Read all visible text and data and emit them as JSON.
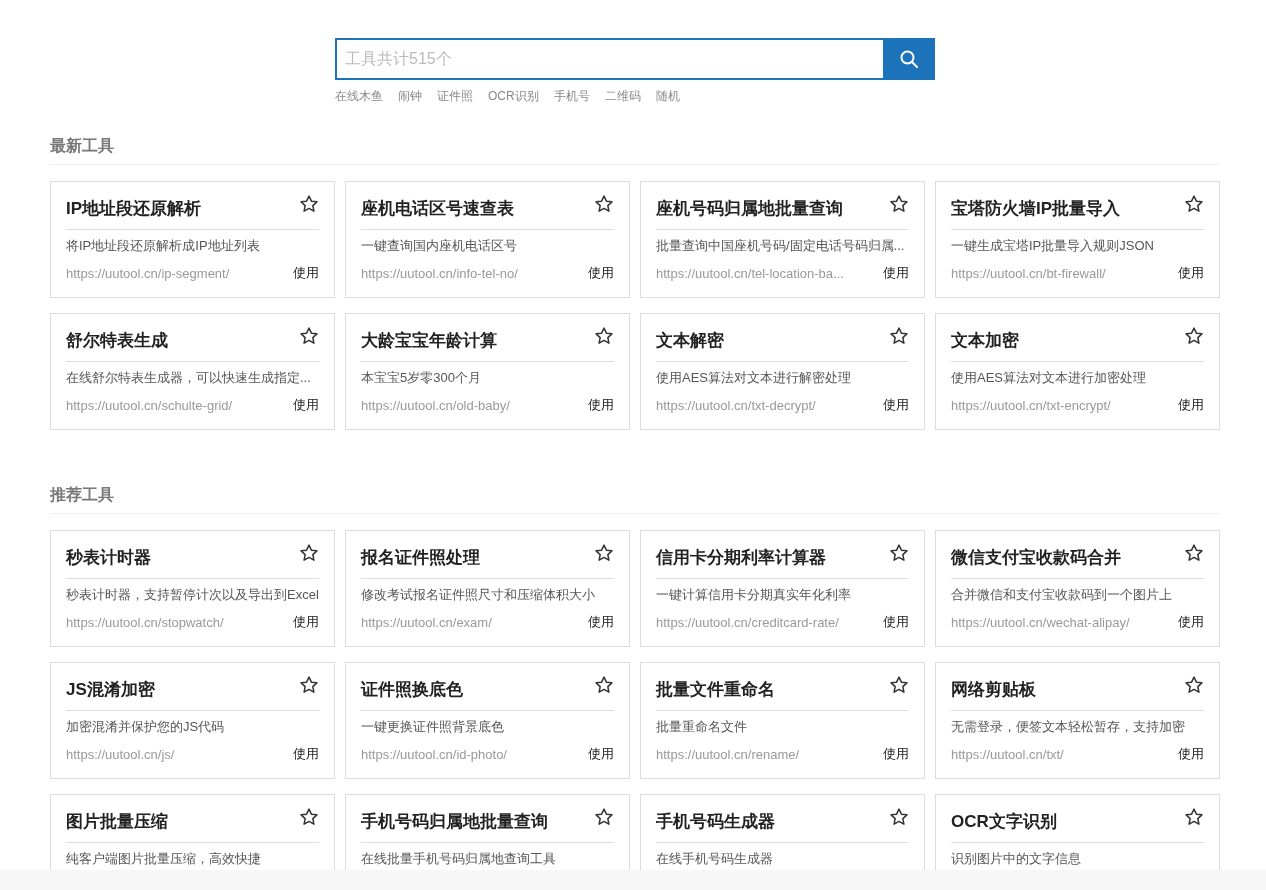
{
  "search": {
    "placeholder": "工具共计515个",
    "hot_words": [
      "在线木鱼",
      "闹钟",
      "证件照",
      "OCR识别",
      "手机号",
      "二维码",
      "随机"
    ]
  },
  "sections": [
    {
      "title": "最新工具",
      "cards": [
        {
          "title": "IP地址段还原解析",
          "description": "将IP地址段还原解析成IP地址列表",
          "url": "https://uutool.cn/ip-segment/",
          "action": "使用"
        },
        {
          "title": "座机电话区号速查表",
          "description": "一键查询国内座机电话区号",
          "url": "https://uutool.cn/info-tel-no/",
          "action": "使用"
        },
        {
          "title": "座机号码归属地批量查询",
          "description": "批量查询中国座机号码/固定电话号码归属...",
          "url": "https://uutool.cn/tel-location-ba...",
          "action": "使用"
        },
        {
          "title": "宝塔防火墙IP批量导入",
          "description": "一键生成宝塔IP批量导入规则JSON",
          "url": "https://uutool.cn/bt-firewall/",
          "action": "使用"
        },
        {
          "title": "舒尔特表生成",
          "description": "在线舒尔特表生成器，可以快速生成指定...",
          "url": "https://uutool.cn/schulte-grid/",
          "action": "使用"
        },
        {
          "title": "大龄宝宝年龄计算",
          "description": "本宝宝5岁零300个月",
          "url": "https://uutool.cn/old-baby/",
          "action": "使用"
        },
        {
          "title": "文本解密",
          "description": "使用AES算法对文本进行解密处理",
          "url": "https://uutool.cn/txt-decrypt/",
          "action": "使用"
        },
        {
          "title": "文本加密",
          "description": "使用AES算法对文本进行加密处理",
          "url": "https://uutool.cn/txt-encrypt/",
          "action": "使用"
        }
      ]
    },
    {
      "title": "推荐工具",
      "cards": [
        {
          "title": "秒表计时器",
          "description": "秒表计时器，支持暂停计次以及导出到Excel",
          "url": "https://uutool.cn/stopwatch/",
          "action": "使用"
        },
        {
          "title": "报名证件照处理",
          "description": "修改考试报名证件照尺寸和压缩体积大小",
          "url": "https://uutool.cn/exam/",
          "action": "使用"
        },
        {
          "title": "信用卡分期利率计算器",
          "description": "一键计算信用卡分期真实年化利率",
          "url": "https://uutool.cn/creditcard-rate/",
          "action": "使用"
        },
        {
          "title": "微信支付宝收款码合并",
          "description": "合并微信和支付宝收款码到一个图片上",
          "url": "https://uutool.cn/wechat-alipay/",
          "action": "使用"
        },
        {
          "title": "JS混淆加密",
          "description": "加密混淆并保护您的JS代码",
          "url": "https://uutool.cn/js/",
          "action": "使用"
        },
        {
          "title": "证件照换底色",
          "description": "一键更换证件照背景底色",
          "url": "https://uutool.cn/id-photo/",
          "action": "使用"
        },
        {
          "title": "批量文件重命名",
          "description": "批量重命名文件",
          "url": "https://uutool.cn/rename/",
          "action": "使用"
        },
        {
          "title": "网络剪贴板",
          "description": "无需登录，便签文本轻松暂存，支持加密",
          "url": "https://uutool.cn/txt/",
          "action": "使用"
        },
        {
          "title": "图片批量压缩",
          "description": "纯客户端图片批量压缩，高效快捷"
        },
        {
          "title": "手机号码归属地批量查询",
          "description": "在线批量手机号码归属地查询工具"
        },
        {
          "title": "手机号码生成器",
          "description": "在线手机号码生成器"
        },
        {
          "title": "OCR文字识别",
          "description": "识别图片中的文字信息"
        }
      ]
    }
  ]
}
